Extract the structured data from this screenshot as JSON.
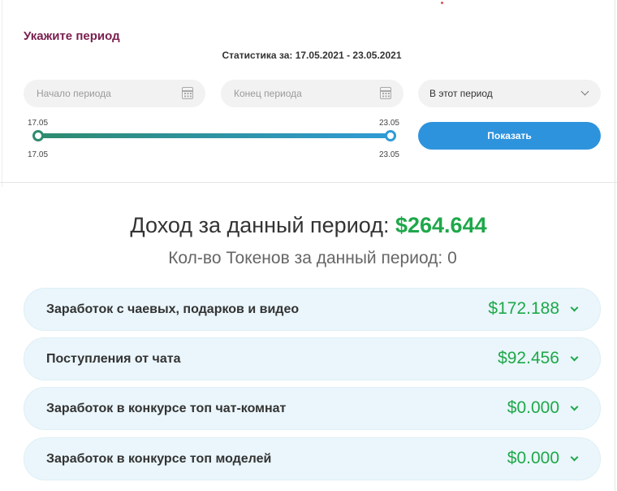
{
  "period": {
    "title": "Укажите период",
    "stats_range": "Статистика за: 17.05.2021 - 23.05.2021",
    "start_placeholder": "Начало периода",
    "end_placeholder": "Конец периода",
    "period_select_value": "В этот период",
    "slider": {
      "top_left": "17.05",
      "top_right": "23.05",
      "bottom_left": "17.05",
      "bottom_right": "23.05"
    },
    "show_button": "Показать"
  },
  "summary": {
    "income_label": "Доход за данный период:",
    "income_value": "$264.644",
    "tokens_text": "Кол-во Токенов за данный период: 0"
  },
  "earnings": [
    {
      "label": "Заработок с чаевых, подарков и видео",
      "amount": "$172.188"
    },
    {
      "label": "Поступления от чата",
      "amount": "$92.456"
    },
    {
      "label": "Заработок в конкурсе топ чат-комнат",
      "amount": "$0.000"
    },
    {
      "label": "Заработок в конкурсе топ моделей",
      "amount": "$0.000"
    }
  ],
  "colors": {
    "accent_blue": "#2d93dd",
    "money_green": "#1ea84a",
    "title_maroon": "#7a1f4e",
    "row_bg": "#eaf6fb"
  }
}
